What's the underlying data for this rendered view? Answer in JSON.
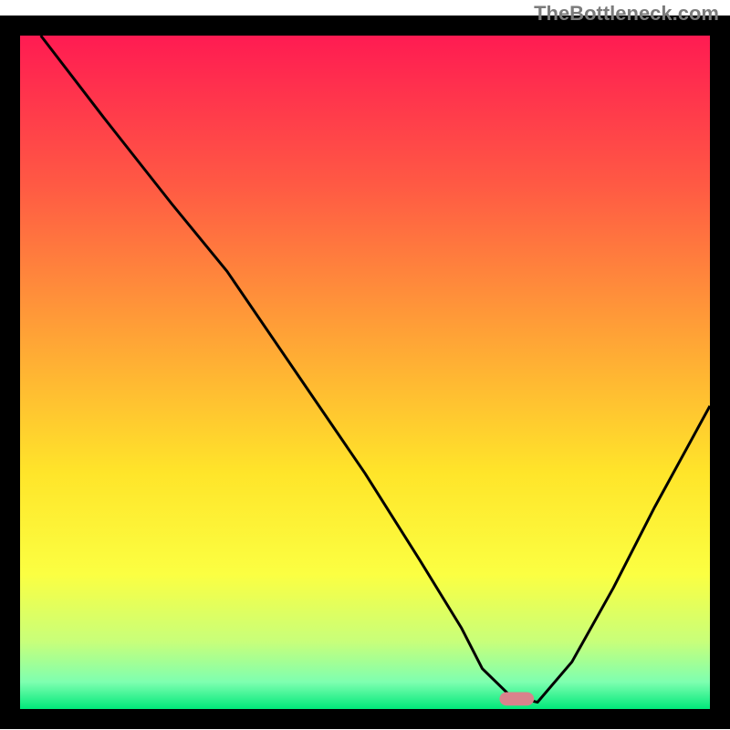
{
  "watermark": "TheBottleneck.com",
  "chart_data": {
    "type": "line",
    "title": "",
    "xlabel": "",
    "ylabel": "",
    "xlim": [
      0,
      100
    ],
    "ylim": [
      0,
      100
    ],
    "background_gradient": {
      "stops": [
        {
          "offset": 0.0,
          "color": "#ff1b52"
        },
        {
          "offset": 0.22,
          "color": "#ff5944"
        },
        {
          "offset": 0.45,
          "color": "#ffa436"
        },
        {
          "offset": 0.65,
          "color": "#ffe52a"
        },
        {
          "offset": 0.8,
          "color": "#fbff42"
        },
        {
          "offset": 0.9,
          "color": "#c8ff7a"
        },
        {
          "offset": 0.96,
          "color": "#7effb0"
        },
        {
          "offset": 1.0,
          "color": "#00e87a"
        }
      ]
    },
    "series": [
      {
        "name": "bottleneck-curve",
        "color": "#000000",
        "x": [
          3,
          12,
          22,
          30,
          40,
          50,
          58,
          64,
          67,
          71,
          75,
          80,
          86,
          92,
          100
        ],
        "y": [
          100,
          88,
          75,
          65,
          50,
          35,
          22,
          12,
          6,
          2,
          1,
          7,
          18,
          30,
          45
        ]
      }
    ],
    "marker": {
      "x": 72,
      "y": 1.5,
      "w": 5,
      "h": 2,
      "color": "#d9828c"
    }
  }
}
